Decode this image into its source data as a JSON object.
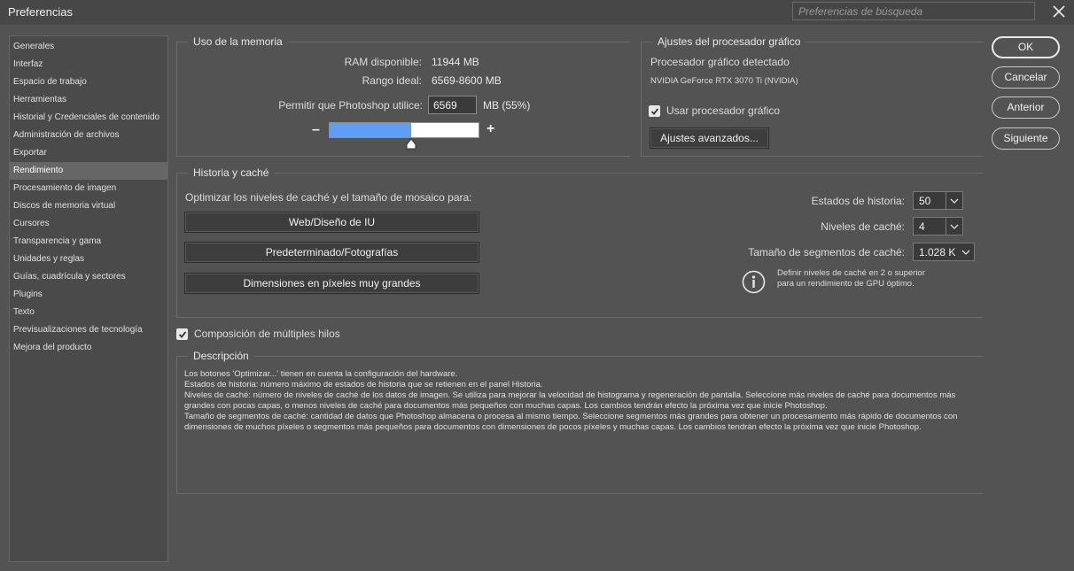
{
  "window": {
    "title": "Preferencias"
  },
  "search": {
    "placeholder": "Preferencias de búsqueda"
  },
  "sidebar": {
    "items": [
      {
        "label": "Generales"
      },
      {
        "label": "Interfaz"
      },
      {
        "label": "Espacio de trabajo"
      },
      {
        "label": "Herramientas"
      },
      {
        "label": "Historial y Credenciales de contenido"
      },
      {
        "label": "Administración de archivos"
      },
      {
        "label": "Exportar"
      },
      {
        "label": "Rendimiento"
      },
      {
        "label": "Procesamiento de imagen"
      },
      {
        "label": "Discos de memoria virtual"
      },
      {
        "label": "Cursores"
      },
      {
        "label": "Transparencia y gama"
      },
      {
        "label": "Unidades y reglas"
      },
      {
        "label": "Guías, cuadrícula y sectores"
      },
      {
        "label": "Plugins"
      },
      {
        "label": "Texto"
      },
      {
        "label": "Previsualizaciones de tecnología"
      },
      {
        "label": "Mejora del producto"
      }
    ],
    "active_index": 7
  },
  "memory": {
    "title": "Uso de la memoria",
    "ram_label": "RAM disponible:",
    "ram_value": "11944 MB",
    "ideal_label": "Rango ideal:",
    "ideal_value": "6569-8600 MB",
    "allow_label": "Permitir que Photoshop utilice:",
    "allow_value": "6569",
    "allow_unit": "MB (55%)",
    "minus": "–",
    "plus": "+",
    "slider_fraction": 0.55
  },
  "gpu": {
    "title": "Ajustes del procesador gráfico",
    "detected_label": "Procesador gráfico detectado",
    "gpu_name": "NVIDIA GeForce RTX 3070 Ti (NVIDIA)",
    "use_gpu_label": "Usar procesador gráfico",
    "use_gpu_checked": true,
    "advanced_button": "Ajustes avanzados..."
  },
  "actions": {
    "ok": "OK",
    "cancel": "Cancelar",
    "prev": "Anterior",
    "next": "Siguiente"
  },
  "history": {
    "title": "Historia y caché",
    "optimize_label": "Optimizar los niveles de caché y el tamaño de mosaico para:",
    "btn_web": "Web/Diseño de IU",
    "btn_default": "Predeterminado/Fotografías",
    "btn_large": "Dimensiones en píxeles muy grandes",
    "states_label": "Estados de historia:",
    "states_value": "50",
    "cache_levels_label": "Niveles de caché:",
    "cache_levels_value": "4",
    "tile_size_label": "Tamaño de segmentos de caché:",
    "tile_size_value": "1.028 K",
    "info_text": "Definir niveles de caché en 2 o superior para un rendimiento de GPU óptimo."
  },
  "multithread": {
    "label": "Composición de múltiples hilos",
    "checked": true
  },
  "description": {
    "title": "Descripción",
    "lines": [
      "Los botones 'Optimizar...' tienen en cuenta la configuración del hardware.",
      "Estados de historia: número máximo de estados de historia que se retienen en el panel Historia.",
      "Niveles de caché: número de niveles de caché de los datos de imagen. Se utiliza para mejorar la velocidad de histograma y regeneración de pantalla. Seleccione más niveles de caché para documentos más grandes con pocas capas, o menos niveles de caché para documentos más pequeños con muchas capas. Los cambios tendrán efecto la próxima vez que inicie Photoshop.",
      "Tamaño de segmentos de caché: cantidad de datos que Photoshop almacena o procesa al mismo tiempo. Seleccione segmentos más grandes para obtener un procesamiento más rápido de documentos con dimensiones de muchos píxeles o segmentos más pequeños para documentos con dimensiones de pocos píxeles y muchas capas. Los cambios tendrán efecto la próxima vez que inicie Photoshop."
    ]
  }
}
